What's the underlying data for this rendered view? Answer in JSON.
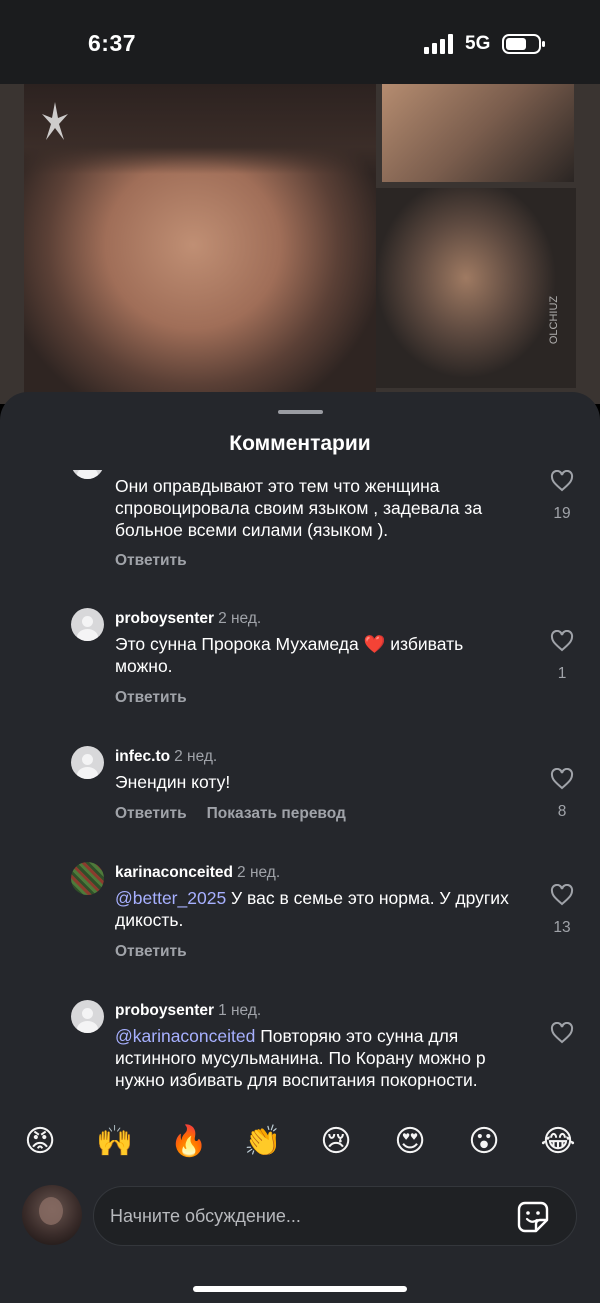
{
  "status": {
    "time": "6:37",
    "network": "5G"
  },
  "media": {
    "watermark": "OLCHIUZ"
  },
  "sheet": {
    "title": "Комментарии"
  },
  "comments": [
    {
      "user": "",
      "time": "",
      "text": "Они оправдывают это тем что женщина спровоцировала своим языком , задевала за больное всеми силами (языком ).",
      "mention": "",
      "likes": "19",
      "reply": "Ответить",
      "translate": ""
    },
    {
      "user": "proboysenter",
      "time": "2 нед.",
      "text_before": "Это сунна Пророка Мухамеда ",
      "emoji": "❤️",
      "text_after": " избивать можно.",
      "likes": "1",
      "reply": "Ответить"
    },
    {
      "user": "infec.to",
      "time": "2 нед.",
      "text": "Энендин коту!",
      "likes": "8",
      "reply": "Ответить",
      "translate": "Показать перевод"
    },
    {
      "user": "karinaconceited",
      "time": "2 нед.",
      "mention": "@better_2025",
      "text": " У вас в семье это норма. У других дикость.",
      "likes": "13",
      "reply": "Ответить"
    },
    {
      "user": "proboysenter",
      "time": "1 нед.",
      "mention": "@karinaconceited",
      "text": " Повторяю это сунна для истинного мусульманина. По Корану можно р нужно избивать для воспитания покорности.",
      "likes": ""
    }
  ],
  "reactions": [
    "😡",
    "🙌",
    "🔥",
    "👏",
    "😢",
    "😍",
    "😮",
    "😂"
  ],
  "composer": {
    "placeholder": "Начните обсуждение..."
  },
  "colors": {
    "sheet_bg": "#25272c",
    "mention": "#a7b0ff",
    "muted": "#a0a3a9"
  }
}
